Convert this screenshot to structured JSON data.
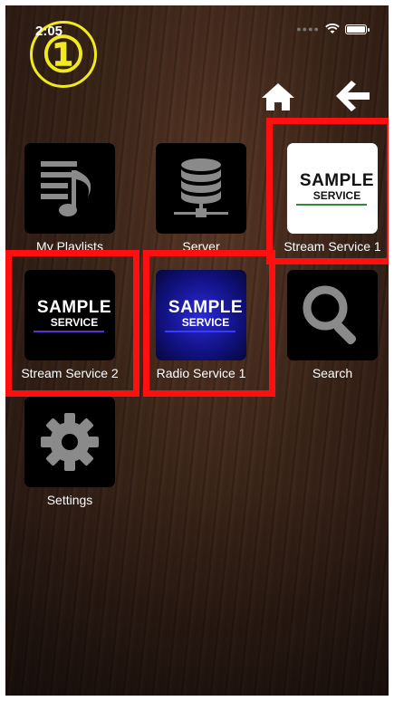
{
  "status_bar": {
    "time": "2:05"
  },
  "step_badge": "①",
  "nav": {
    "home_icon": "home-icon",
    "back_icon": "back-arrow-icon"
  },
  "tiles": [
    {
      "label": "My Playlists",
      "icon": "music-list-icon"
    },
    {
      "label": "Server",
      "icon": "server-database-icon"
    },
    {
      "label": "Stream Service 1",
      "logo_main": "SAMPLE",
      "logo_sub": "SERVICE",
      "style": "white"
    },
    {
      "label": "Stream Service 2",
      "logo_main": "SAMPLE",
      "logo_sub": "SERVICE",
      "style": "black"
    },
    {
      "label": "Radio Service 1",
      "logo_main": "SAMPLE",
      "logo_sub": "SERVICE",
      "style": "blue"
    },
    {
      "label": "Search",
      "icon": "search-icon"
    },
    {
      "label": "Settings",
      "icon": "gear-icon"
    }
  ],
  "colors": {
    "highlight": "#ff1010",
    "badge": "#f0ea1e",
    "logo_green": "#2e8b3a",
    "logo_purple": "#5b2fd6"
  }
}
